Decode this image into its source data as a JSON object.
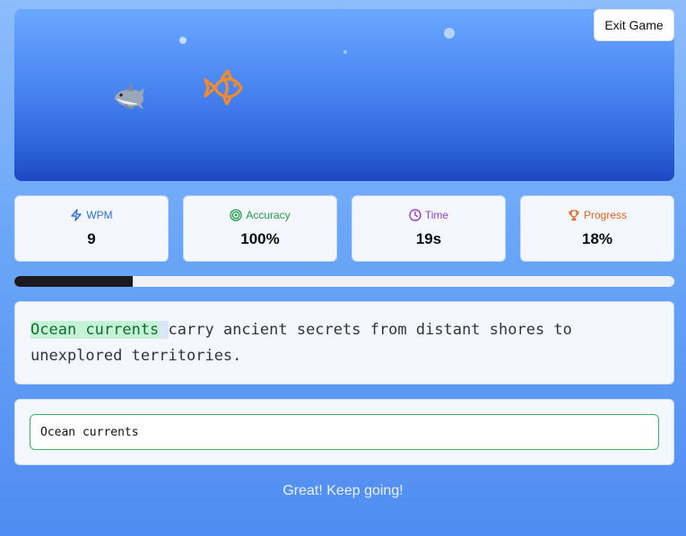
{
  "header": {
    "exit_label": "Exit Game"
  },
  "scene": {
    "shark_emoji": "🦈",
    "fish_icon": "fish-icon",
    "bubble_count_visible": 3
  },
  "stats": {
    "wpm": {
      "label": "WPM",
      "value": "9",
      "color": "#2e6fd8",
      "icon": "lightning-icon"
    },
    "accuracy": {
      "label": "Accuracy",
      "value": "100%",
      "color": "#1f9d47",
      "icon": "target-icon"
    },
    "time": {
      "label": "Time",
      "value": "19s",
      "color": "#9b3fc5",
      "icon": "clock-icon"
    },
    "progress": {
      "label": "Progress",
      "value": "18%",
      "color": "#e0621b",
      "icon": "trophy-icon"
    }
  },
  "progress_bar": {
    "fraction": 0.18,
    "fill_color": "#1b1b1f"
  },
  "passage": {
    "typed": "Ocean currents",
    "current": " ",
    "remaining": "carry ancient secrets from distant shores to unexplored territories."
  },
  "input": {
    "value": "Ocean currents",
    "border_color": "#3bb55d"
  },
  "feedback": {
    "message": "Great! Keep going!"
  }
}
